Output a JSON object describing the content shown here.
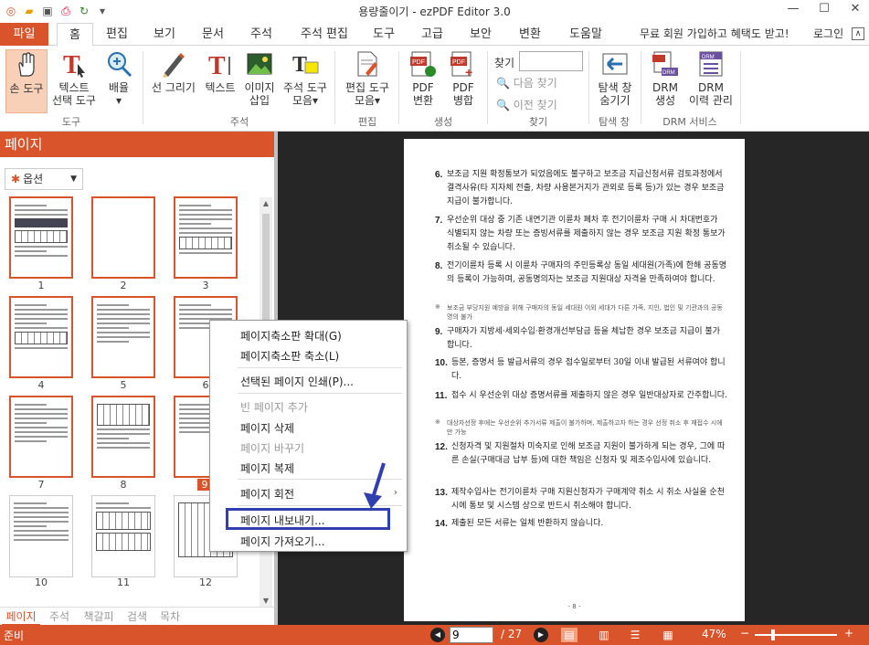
{
  "window": {
    "title": "용량줄이기 - ezPDF Editor 3.0",
    "controls": [
      "—",
      "☐",
      "✕"
    ]
  },
  "menu": {
    "file": "파일",
    "tabs": [
      "홈",
      "편집",
      "보기",
      "문서",
      "주석",
      "주석 편집",
      "도구",
      "고급",
      "보안",
      "변환",
      "도움말"
    ],
    "active_tab": "홈",
    "promo": "무료 회원 가입하고 혜택도 받고!",
    "login": "로그인"
  },
  "ribbon": {
    "hand_tool": "손 도구",
    "text_select_1": "텍스트",
    "text_select_2": "선택 도구",
    "zoom_1": "배율",
    "zoom_2": "▾",
    "group_tools": "도구",
    "draw_line": "선 그리기",
    "text": "텍스트",
    "image_1": "이미지",
    "image_2": "삽입",
    "annot_tools_1": "주석 도구",
    "annot_tools_2": "모음▾",
    "group_annot": "주석",
    "edit_tools_1": "편집 도구",
    "edit_tools_2": "모음▾",
    "group_edit": "편집",
    "pdf_convert_1": "PDF",
    "pdf_convert_2": "변환",
    "pdf_merge_1": "PDF",
    "pdf_merge_2": "병합",
    "group_create": "생성",
    "find_label": "찾기",
    "find_next": "다음 찾기",
    "find_prev": "이전 찾기",
    "group_find": "찾기",
    "hide_nav_1": "탐색 창",
    "hide_nav_2": "숨기기",
    "group_nav": "탐색 창",
    "drm_create_1": "DRM",
    "drm_create_2": "생성",
    "drm_history_1": "DRM",
    "drm_history_2": "이력 관리",
    "group_drm": "DRM 서비스"
  },
  "left_panel": {
    "title": "페이지",
    "options": "옵션",
    "thumbs": [
      "1",
      "2",
      "3",
      "4",
      "5",
      "6",
      "7",
      "8",
      "9",
      "10",
      "11",
      "12"
    ],
    "bottom_tabs": [
      "페이지",
      "주석",
      "책갈피",
      "검색",
      "목차"
    ]
  },
  "context_menu": {
    "items": [
      {
        "label": "페이지축소판 확대(G)",
        "disabled": false
      },
      {
        "label": "페이지축소판 축소(L)",
        "disabled": false
      },
      {
        "label": "선택된 페이지 인쇄(P)...",
        "disabled": false
      },
      {
        "label": "빈 페이지 추가",
        "disabled": true
      },
      {
        "label": "페이지 삭제",
        "disabled": false
      },
      {
        "label": "페이지 바꾸기",
        "disabled": true
      },
      {
        "label": "페이지 복제",
        "disabled": false
      },
      {
        "label": "페이지 회전",
        "disabled": false
      },
      {
        "label": "페이지 내보내기...",
        "disabled": false
      },
      {
        "label": "페이지 가져오기...",
        "disabled": false
      }
    ]
  },
  "document": {
    "items": [
      {
        "no": "6.",
        "text": "보조금 지원 확정통보가 되었음에도 불구하고 보조금 지급신청서류 검토과정에서 결격사유(타 지자체 전출, 차량 사용본거지가 관외로 등록 등)가 있는 경우 보조금 지급이 불가합니다."
      },
      {
        "no": "7.",
        "text": "우선순위 대상 중 기존 내연기관 이륜차 폐차 후 전기이륜차 구매 시 차대번호가 식별되지 않는 차량 또는 증빙서류를 제출하지 않는 경우 보조금 지원 확정 통보가 취소될 수 있습니다."
      },
      {
        "no": "8.",
        "text": "전기이륜차 등록 시 이륜차 구매자의 주민등록상 동일 세대원(가족)에 한해 공동명의 등록이 가능하며, 공동명의자는 보조금 지원대상 자격을 만족하여야 합니다."
      },
      {
        "no": "※",
        "text": "보조금 부당지원 예방을 위해 구매자의 동일 세대원 이외 세대가 다른 가족, 지인, 법인 및 기관과의 공동명의 불가",
        "note": true
      },
      {
        "no": "9.",
        "text": "구매자가 지방세·세외수입·환경개선부담금 등을 체납한 경우 보조금 지급이 불가합니다."
      },
      {
        "no": "10.",
        "text": "등본, 증명서 등 발급서류의 경우 접수일로부터 30일 이내 발급된 서류여야 합니다."
      },
      {
        "no": "11.",
        "text": "접수 시 우선순위 대상 증명서류를 제출하지 않은 경우 일반대상자로 간주합니다."
      },
      {
        "no": "※",
        "text": "대상자선정 후에는 우선순위 추가서류 제출이 불가하며, 제출하고자 하는 경우 선정 취소 후 재접수 시에만 가능",
        "note": true
      },
      {
        "no": "12.",
        "text": "신청자격 및 지원절차 미숙지로 인해 보조금 지원이 불가하게 되는 경우, 그에 따른 손실(구매대금 납부 등)에 대한 책임은 신청자 및 제조수입사에 있습니다."
      },
      {
        "no": "13.",
        "text": "제작수입사는 전기이륜차 구매 지원신청자가 구매계약 취소 시 취소 사실을 순천시에 통보 및 시스템 상으로 반드시 취소해야 합니다."
      },
      {
        "no": "14.",
        "text": "제출된 모든 서류는 일체 반환하지 않습니다."
      }
    ],
    "page_label": "- 8 -"
  },
  "status": {
    "ready": "준비",
    "current_page": "9",
    "total_pages": "/ 27",
    "zoom": "47%",
    "zoom_minus": "−",
    "zoom_plus": "+"
  },
  "colors": {
    "accent": "#d9542b",
    "doc_bg": "#262626",
    "highlight_box": "#2f3fb0"
  }
}
